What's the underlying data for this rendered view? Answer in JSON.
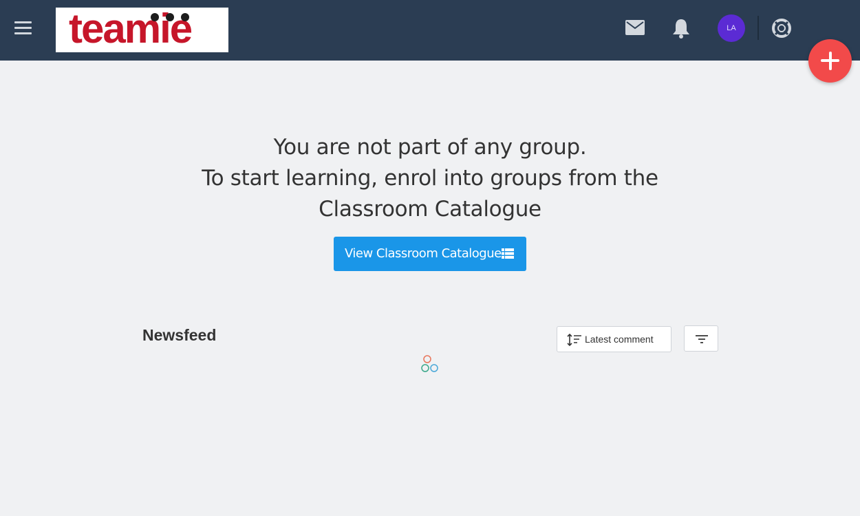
{
  "header": {
    "menu_icon": "hamburger-menu-icon",
    "logo_text": "teamie",
    "mail_icon": "envelope-icon",
    "notification_icon": "bell-icon",
    "avatar_initials": "LA",
    "help_icon": "lifebuoy-icon",
    "colors": {
      "bar": "#2b3d53",
      "avatar": "#5b2bd4",
      "logo": "#c6162a"
    }
  },
  "fab": {
    "icon": "plus-icon",
    "color": "#f24a4a"
  },
  "empty_state": {
    "lines": [
      "You are not part of any group.",
      "To start learning, enrol into groups from the",
      "Classroom Catalogue"
    ],
    "button_label": "View Classroom Catalogue",
    "button_icon": "list-icon",
    "button_color": "#1a96e8"
  },
  "newsfeed": {
    "title": "Newsfeed",
    "sort_label": "Latest comment",
    "sort_icon": "sort-icon",
    "filter_icon": "filter-icon",
    "loader_icon": "loading-spinner-icon"
  }
}
